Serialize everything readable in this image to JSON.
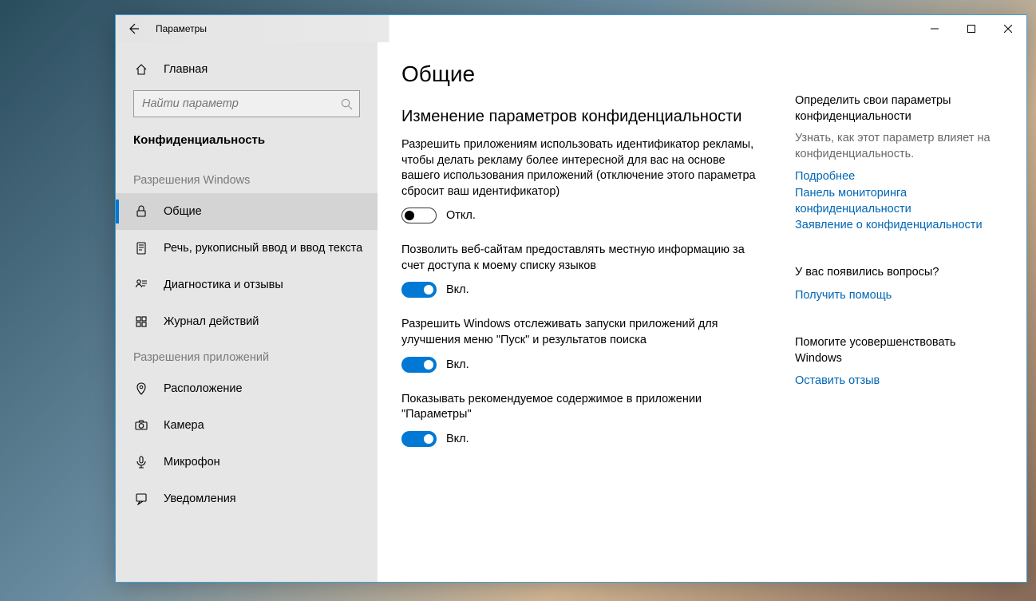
{
  "titlebar": {
    "title": "Параметры"
  },
  "sidebar": {
    "home": "Главная",
    "search_placeholder": "Найти параметр",
    "category": "Конфиденциальность",
    "group1_header": "Разрешения Windows",
    "group1_items": [
      {
        "id": "general",
        "label": "Общие"
      },
      {
        "id": "speech",
        "label": "Речь, рукописный ввод и ввод текста"
      },
      {
        "id": "diagnostics",
        "label": "Диагностика и отзывы"
      },
      {
        "id": "activity",
        "label": "Журнал действий"
      }
    ],
    "group2_header": "Разрешения приложений",
    "group2_items": [
      {
        "id": "location",
        "label": "Расположение"
      },
      {
        "id": "camera",
        "label": "Камера"
      },
      {
        "id": "microphone",
        "label": "Микрофон"
      },
      {
        "id": "notifications",
        "label": "Уведомления"
      }
    ]
  },
  "main": {
    "title": "Общие",
    "section_title": "Изменение параметров конфиденциальности",
    "settings": [
      {
        "desc": "Разрешить приложениям использовать идентификатор рекламы, чтобы делать рекламу более интересной для вас на основе вашего использования приложений (отключение этого параметра сбросит ваш идентификатор)",
        "state": "off",
        "state_label": "Откл."
      },
      {
        "desc": "Позволить веб-сайтам предоставлять местную информацию за счет доступа к моему списку языков",
        "state": "on",
        "state_label": "Вкл."
      },
      {
        "desc": "Разрешить Windows отслеживать запуски приложений для улучшения меню \"Пуск\" и результатов поиска",
        "state": "on",
        "state_label": "Вкл."
      },
      {
        "desc": "Показывать рекомендуемое содержимое в приложении \"Параметры\"",
        "state": "on",
        "state_label": "Вкл."
      }
    ]
  },
  "right": {
    "block1_heading": "Определить свои параметры конфиденциальности",
    "block1_sub": "Узнать, как этот параметр влияет на конфиденциальность.",
    "block1_links": [
      "Подробнее",
      "Панель мониторинга конфиденциальности",
      "Заявление о конфиденциальности"
    ],
    "block2_heading": "У вас появились вопросы?",
    "block2_link": "Получить помощь",
    "block3_heading": "Помогите усовершенствовать Windows",
    "block3_link": "Оставить отзыв"
  }
}
